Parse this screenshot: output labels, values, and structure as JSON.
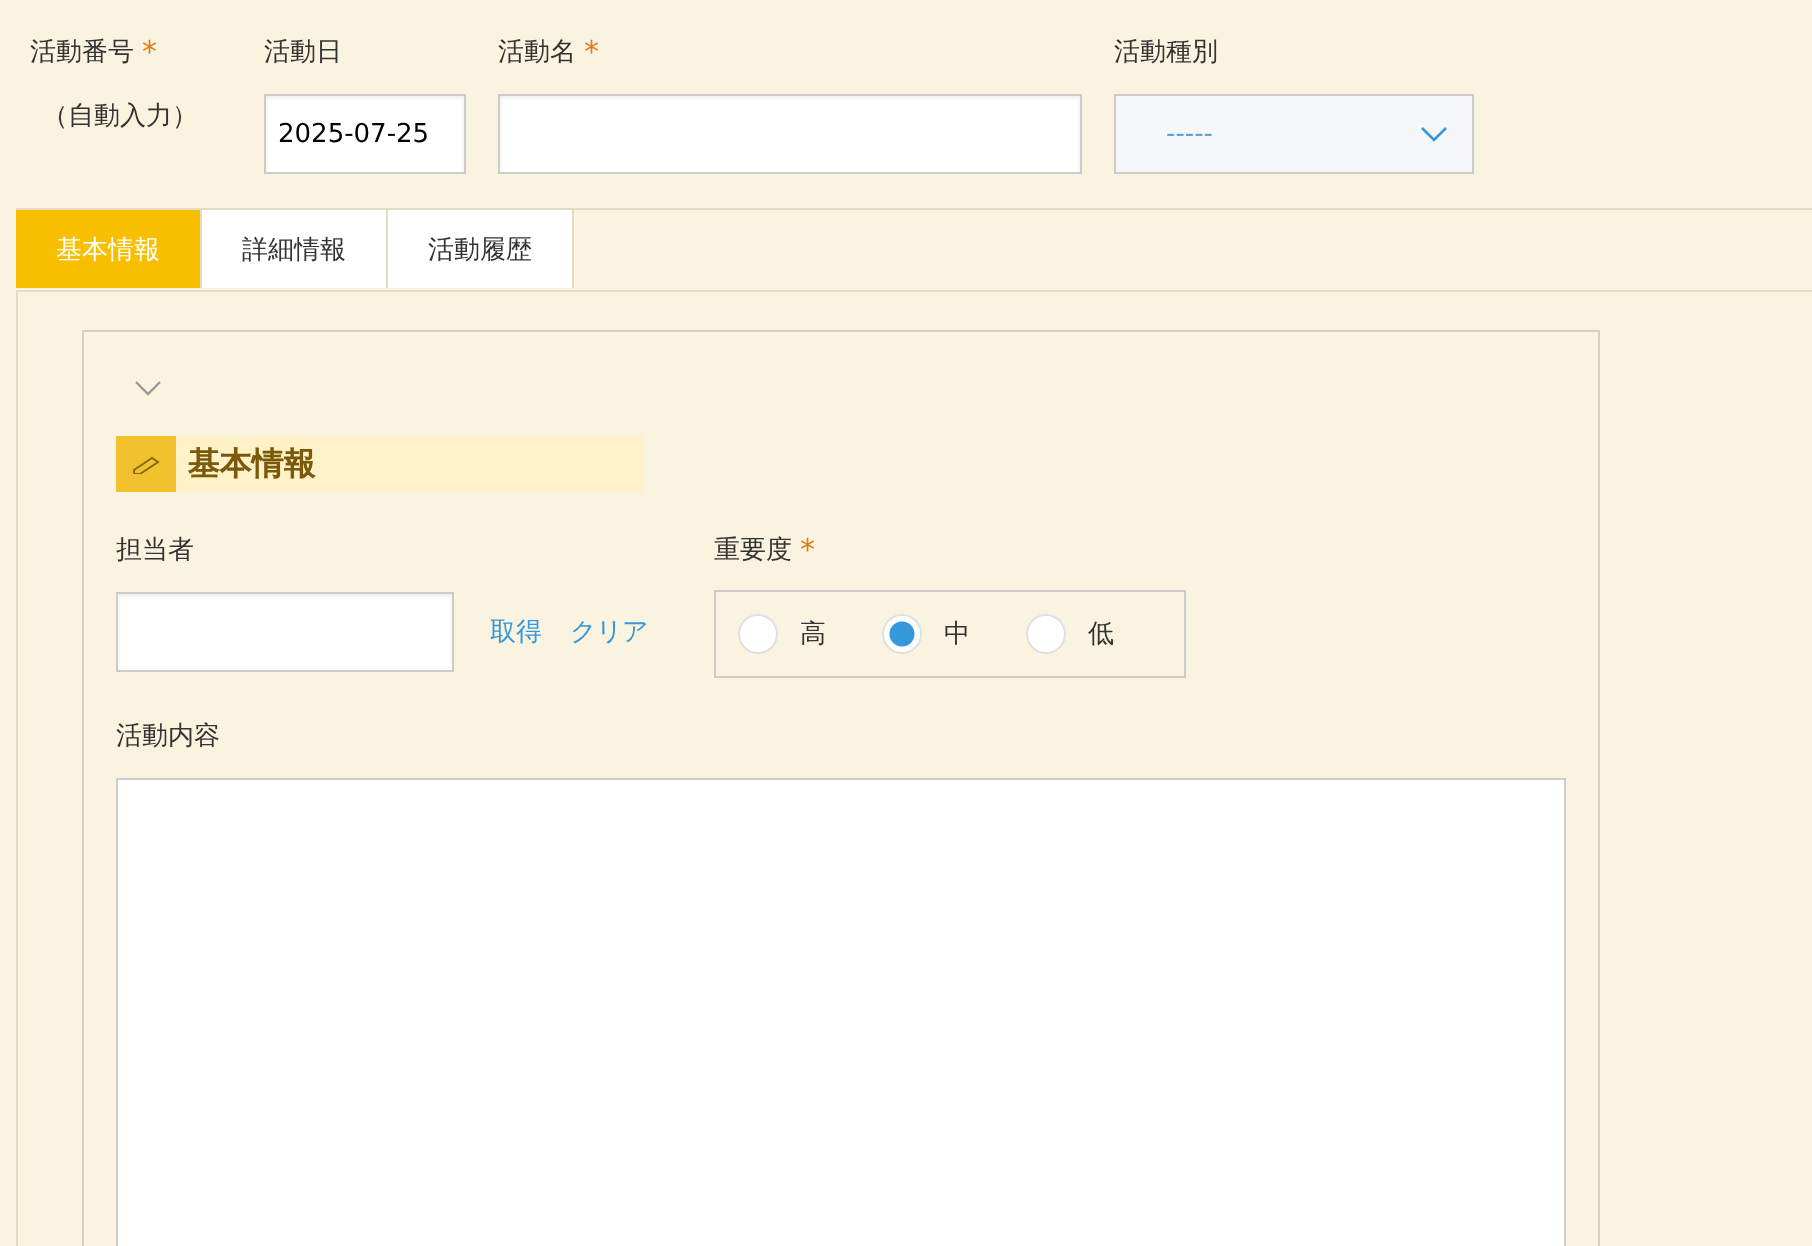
{
  "header_fields": [
    {
      "kind": "static",
      "label": "活動番号",
      "required_mark": "*",
      "value": "（自動入力）"
    },
    {
      "kind": "input",
      "label": "活動日",
      "value": "2025-07-25"
    },
    {
      "kind": "input",
      "label": "活動名",
      "required_mark": "*"
    },
    {
      "kind": "select",
      "label": "活動種別",
      "value": "-----"
    }
  ],
  "tabs": [
    {
      "label": "基本情報",
      "selected": true
    },
    {
      "label": "詳細情報",
      "selected": false
    },
    {
      "label": "活動履歴",
      "selected": false
    }
  ],
  "section": {
    "expanded": true,
    "title": "基本情報",
    "assignee": {
      "label": "担当者",
      "links": [
        "取得",
        "クリア"
      ]
    },
    "importance": {
      "label": "重要度",
      "required_mark": "*",
      "options": [
        {
          "label": "高",
          "selected": false
        },
        {
          "label": "中",
          "selected": true
        },
        {
          "label": "低",
          "selected": false
        }
      ]
    },
    "content": {
      "label": "活動内容"
    }
  }
}
